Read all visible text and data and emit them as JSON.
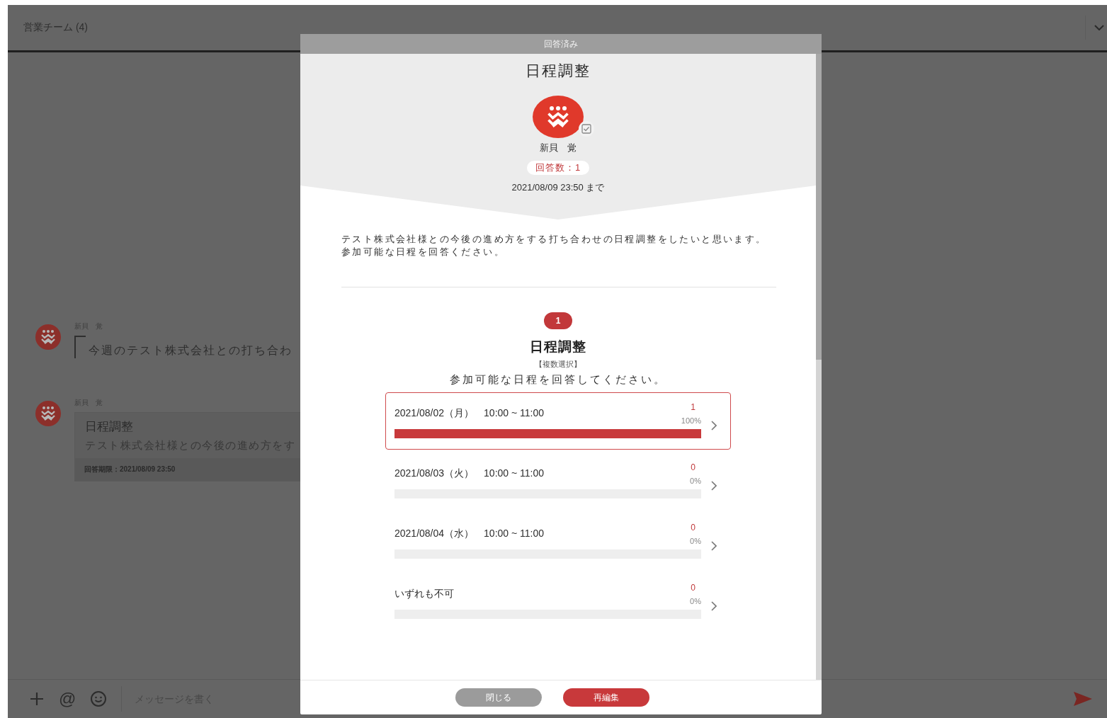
{
  "channel": {
    "title": "営業チーム (4)"
  },
  "messages": [
    {
      "kind": "quote",
      "sender": "新貝　覚",
      "text": "今週のテスト株式会社との打ち合わ"
    },
    {
      "kind": "card",
      "sender": "新貝　覚",
      "title": "日程調整",
      "description": "テスト株式会社様との今後の進め方をす",
      "deadline": "回答期限：2021/08/09 23:50"
    }
  ],
  "composer": {
    "mention_symbol": "@",
    "placeholder": "メッセージを書く"
  },
  "dialog": {
    "status": "回答済み",
    "title": "日程調整",
    "author": "新貝　覚",
    "answer_count": "回答数：1",
    "deadline": "2021/08/09 23:50 まで",
    "description": [
      "テスト株式会社様との今後の進め方をする打ち合わせの日程調整をしたいと思います。",
      "参加可能な日程を回答ください。"
    ],
    "questions": [
      {
        "number": "1",
        "title": "日程調整",
        "mode": "【複数選択】",
        "prompt": "参加可能な日程を回答してください。",
        "options": [
          {
            "label": "2021/08/02（月）　10:00 ~ 11:00",
            "count": "1",
            "percent": "100%",
            "level": 1,
            "selected": true
          },
          {
            "label": "2021/08/03（火）　10:00 ~ 11:00",
            "count": "0",
            "percent": "0%",
            "level": 0,
            "selected": false
          },
          {
            "label": "2021/08/04（水）　10:00 ~ 11:00",
            "count": "0",
            "percent": "0%",
            "level": 0,
            "selected": false
          },
          {
            "label": "いずれも不可",
            "count": "0",
            "percent": "0%",
            "level": 0,
            "selected": false
          }
        ]
      }
    ],
    "buttons": [
      {
        "label": "閉じる",
        "kind": "secondary"
      },
      {
        "label": "再編集",
        "kind": "primary"
      }
    ]
  }
}
